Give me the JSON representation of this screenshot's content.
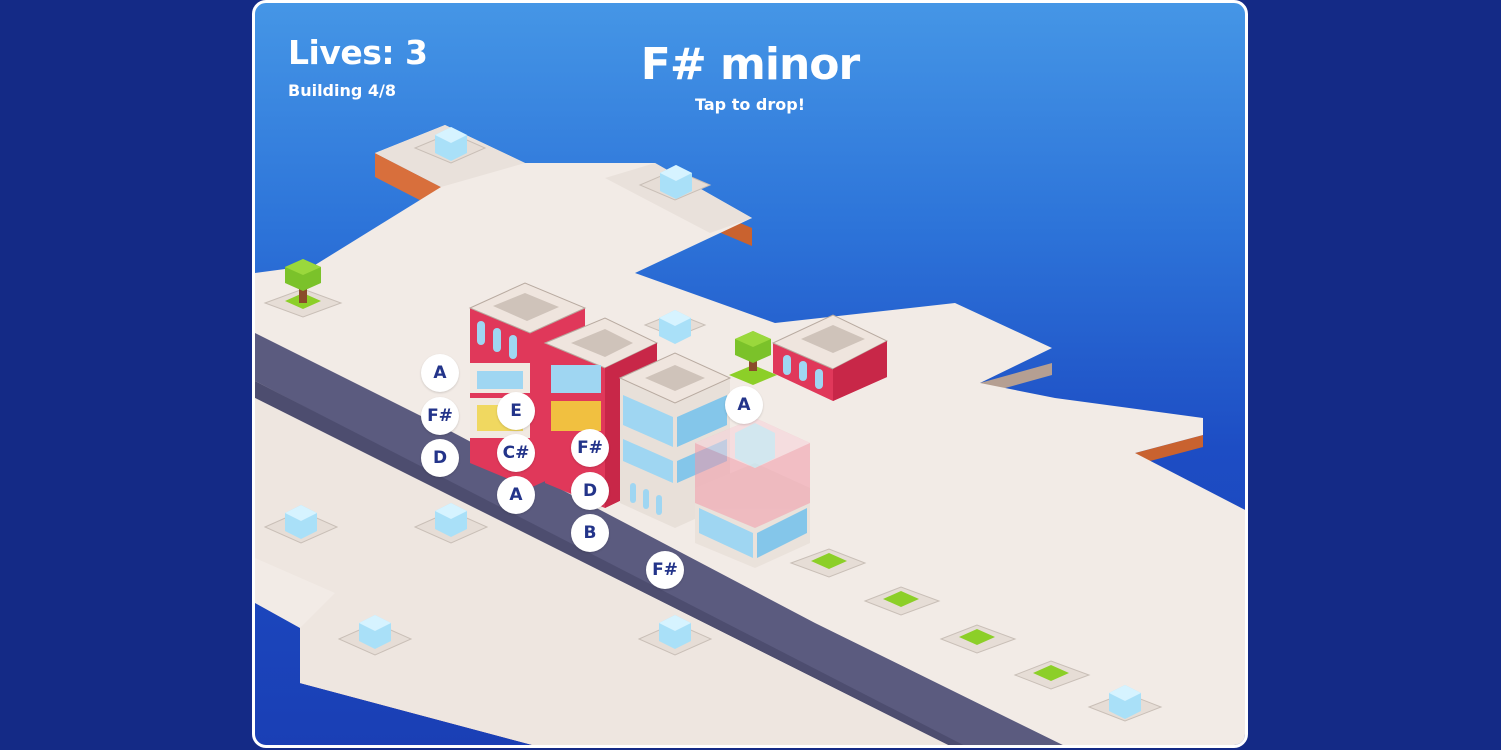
{
  "hud": {
    "lives_label": "Lives: 3",
    "building_progress": "Building 4/8",
    "key_name": "F# minor",
    "instruction": "Tap to drop!"
  },
  "notes": [
    {
      "id": "note-a-1",
      "label": "A"
    },
    {
      "id": "note-fsharp-1",
      "label": "F#"
    },
    {
      "id": "note-d-1",
      "label": "D"
    },
    {
      "id": "note-e",
      "label": "E"
    },
    {
      "id": "note-csharp",
      "label": "C#"
    },
    {
      "id": "note-a-2",
      "label": "A"
    },
    {
      "id": "note-fsharp-2",
      "label": "F#"
    },
    {
      "id": "note-d-2",
      "label": "D"
    },
    {
      "id": "note-b",
      "label": "B"
    },
    {
      "id": "note-fsharp-3",
      "label": "F#"
    },
    {
      "id": "note-a-3",
      "label": "A"
    }
  ],
  "colors": {
    "page_background": "#142a86",
    "sky_top": "#4596e6",
    "sky_bottom": "#1a3fb5",
    "ground": "#f2ebe6",
    "road": "#5b5b7f",
    "building_red": "#e0385a",
    "window_blue": "#9fd6f2",
    "grass": "#8ccf28",
    "note_text": "#23348a"
  },
  "icons": [
    "ice-block-icon",
    "tree-icon",
    "grass-plot-icon",
    "ghost-building-icon"
  ]
}
